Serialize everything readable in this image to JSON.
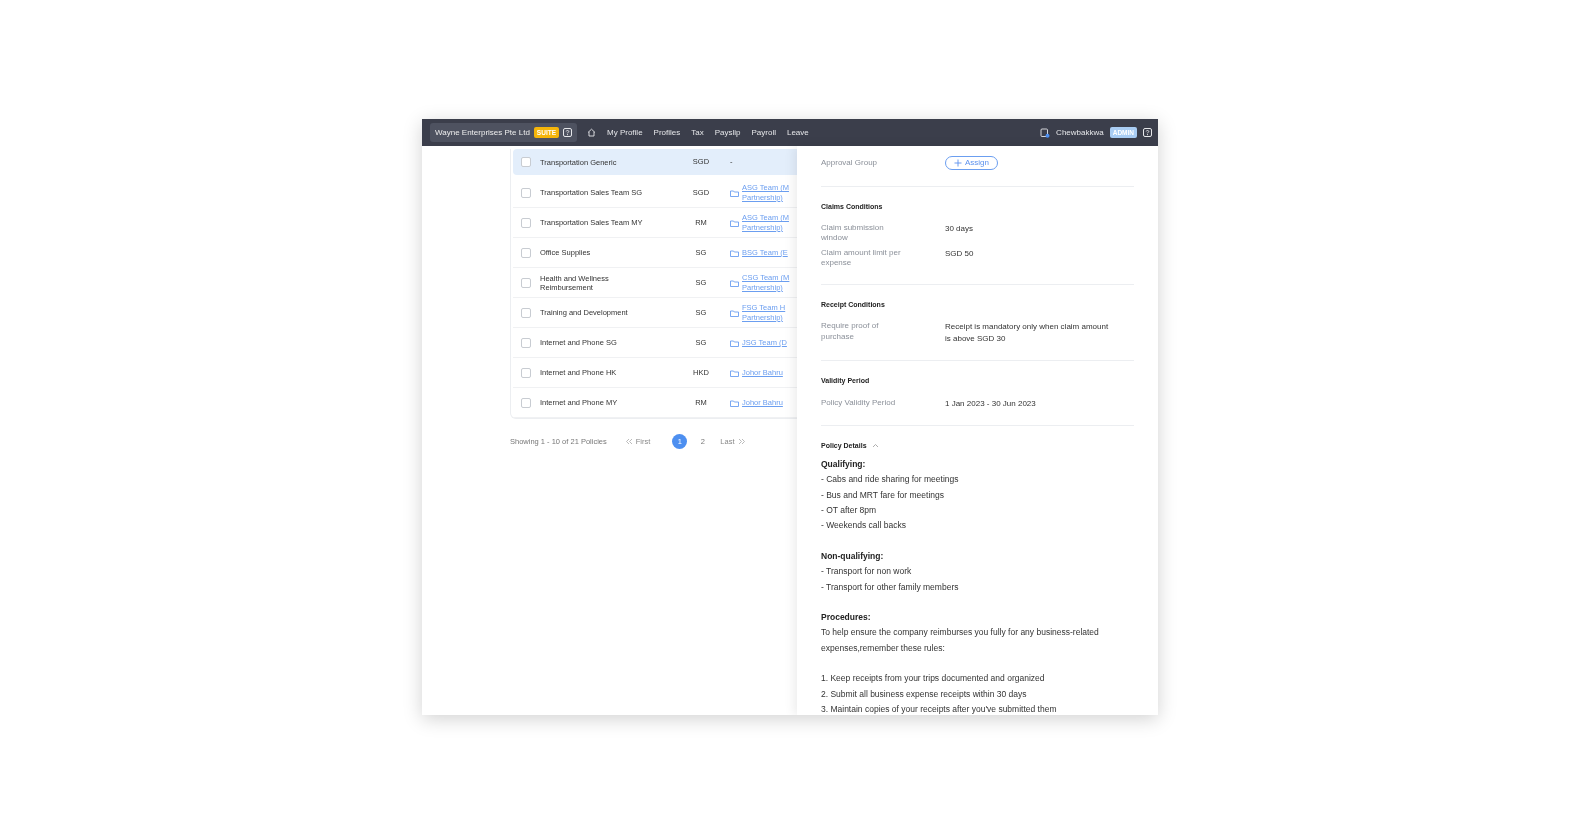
{
  "navbar": {
    "company": "Wayne Enterprises Pte Ltd",
    "company_badge": "SUITE",
    "nav_items": [
      "My Profile",
      "Profiles",
      "Tax",
      "Payslip",
      "Payroll",
      "Leave"
    ],
    "user": "Chewbakkwa",
    "role_badge": "ADMIN"
  },
  "policies": {
    "rows": [
      {
        "name": "Transportation Generic",
        "currency": "SGD",
        "group": [
          "-"
        ],
        "group_link": false,
        "selected": true,
        "checked": false
      },
      {
        "name": "Transportation Sales Team SG",
        "currency": "SGD",
        "group": [
          "ASG Team (M",
          "Partnership)"
        ],
        "group_link": true,
        "selected": false,
        "checked": false
      },
      {
        "name": "Transportation Sales Team MY",
        "currency": "RM",
        "group": [
          "ASG Team (M",
          "Partnership)"
        ],
        "group_link": true,
        "selected": false,
        "checked": false
      },
      {
        "name": "Office Supplies",
        "currency": "SG",
        "group": [
          "BSG Team (E"
        ],
        "group_link": true,
        "selected": false,
        "checked": false
      },
      {
        "name": "Health and Wellness Reimbursement",
        "currency": "SG",
        "group": [
          "CSG Team (M",
          "Partnership)"
        ],
        "group_link": true,
        "selected": false,
        "checked": false
      },
      {
        "name": "Training and Development",
        "currency": "SG",
        "group": [
          "FSG Team H",
          "Partnership)"
        ],
        "group_link": true,
        "selected": false,
        "checked": false
      },
      {
        "name": "Internet and Phone SG",
        "currency": "SG",
        "group": [
          "JSG Team (D"
        ],
        "group_link": true,
        "selected": false,
        "checked": false
      },
      {
        "name": "Internet and Phone HK",
        "currency": "HKD",
        "group": [
          "Johor Bahru"
        ],
        "group_link": true,
        "selected": false,
        "checked": false
      },
      {
        "name": "Internet and Phone MY",
        "currency": "RM",
        "group": [
          "Johor Bahru"
        ],
        "group_link": true,
        "selected": false,
        "checked": false
      }
    ],
    "pagination": {
      "summary": "Showing 1 - 10 of 21 Policies",
      "first": "First",
      "last": "Last",
      "pages": [
        {
          "label": "1",
          "selected": true
        },
        {
          "label": "2",
          "selected": false
        }
      ]
    }
  },
  "details": {
    "approval_group": {
      "label": "Approval Group",
      "button": "Assign"
    },
    "sections": [
      {
        "title": "Claims Conditions",
        "fields": [
          {
            "label": "Claim submission window",
            "value": "30 days"
          },
          {
            "label": "Claim amount limit per expense",
            "value": "SGD 50"
          }
        ]
      },
      {
        "title": "Receipt Conditions",
        "fields": [
          {
            "label": "Require proof of purchase",
            "value": "Receipt is mandatory only when claim amount is above SGD 30"
          }
        ]
      },
      {
        "title": "Validity Period",
        "fields": [
          {
            "label": "Policy Validity Period",
            "value": "1 Jan 2023 - 30 Jun 2023"
          }
        ]
      }
    ],
    "policy_details": {
      "title": "Policy Details",
      "expanded": true,
      "blocks": [
        {
          "heading": "Qualifying:",
          "lines": [
            "- Cabs and ride sharing for meetings",
            "- Bus and MRT fare for meetings",
            "- OT after 8pm",
            "- Weekends call backs"
          ]
        },
        {
          "heading": "Non-qualifying:",
          "lines": [
            "- Transport for non work",
            "- Transport for other family members"
          ]
        },
        {
          "heading": "Procedures:",
          "intro": "To help ensure the company reimburses you fully for any business-related expenses,remember these rules:",
          "lines": [
            "1. Keep receipts from your trips documented and organized",
            "2. Submit all business expense receipts within 30 days",
            "3. Maintain copies of your receipts after you've submitted them"
          ]
        }
      ]
    }
  }
}
